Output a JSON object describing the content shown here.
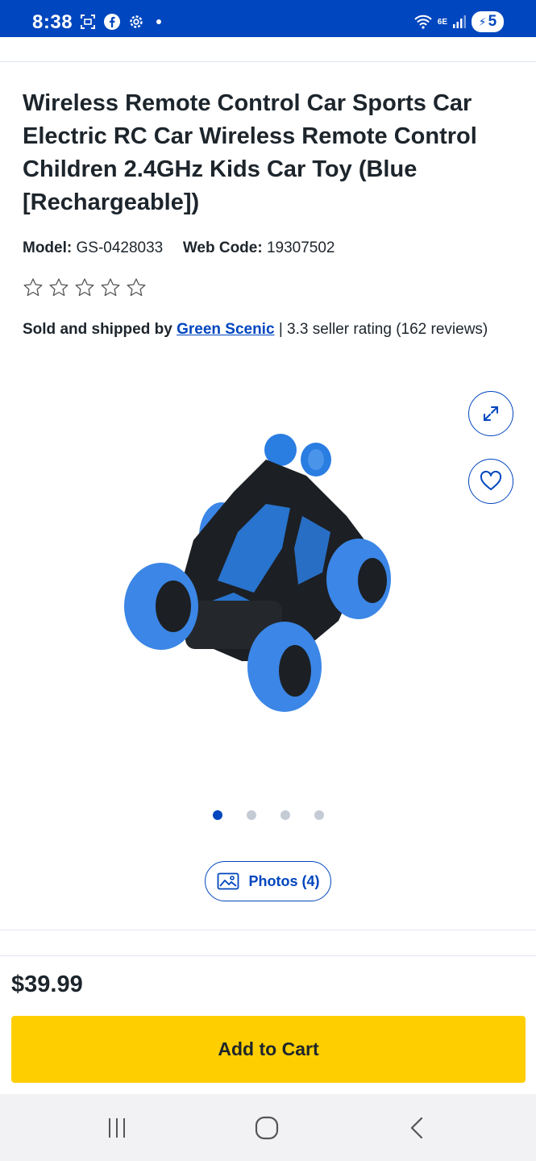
{
  "status_bar": {
    "time": "8:38",
    "battery": "5",
    "network": "6E",
    "icons": [
      "screenshot-icon",
      "facebook-icon",
      "settings-icon",
      "notification-dot",
      "wifi-icon",
      "signal-icon",
      "battery-icon"
    ]
  },
  "product": {
    "title": "Wireless Remote Control Car Sports Car Electric RC Car Wireless Remote Control Children 2.4GHz Kids Car Toy (Blue [Rechargeable])",
    "model_label": "Model:",
    "model_value": "GS-0428033",
    "webcode_label": "Web Code:",
    "webcode_value": "19307502",
    "rating_stars": 0,
    "rating_max": 5,
    "seller_prefix": "Sold and shipped by",
    "seller_name": "Green Scenic",
    "seller_suffix": "| 3.3 seller rating (162 reviews)"
  },
  "gallery": {
    "image_icon": "rc-car-product-image",
    "dots_total": 4,
    "dots_active": 1,
    "photos_label": "Photos (4)"
  },
  "purchase": {
    "price": "$39.99",
    "add_to_cart_label": "Add to Cart"
  },
  "colors": {
    "brand_blue": "#0046be",
    "cart_yellow": "#ffce00",
    "text_dark": "#1d252c"
  }
}
